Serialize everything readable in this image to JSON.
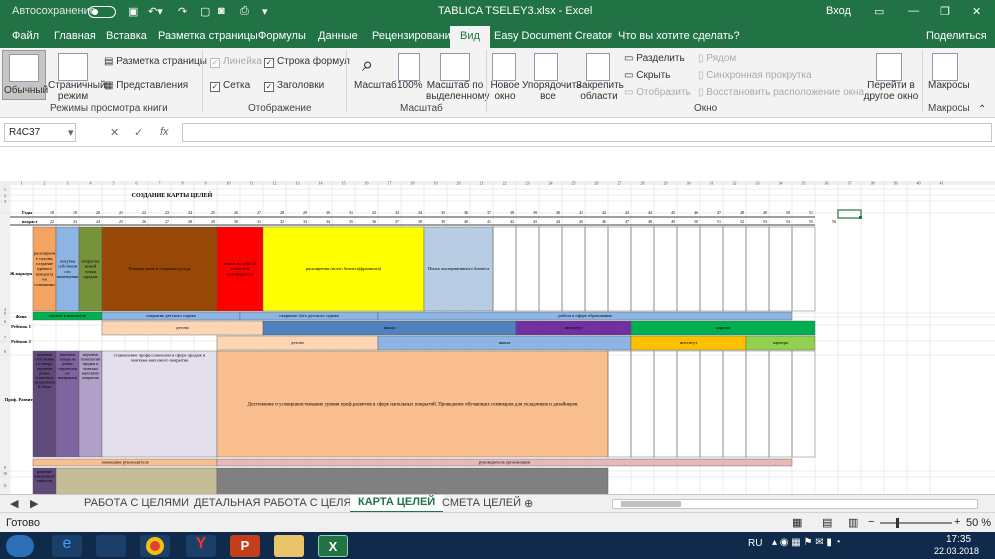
{
  "title_bar": {
    "autosave": "Автосохранение",
    "autosave_state": "Откл.",
    "file_name": "TABLICA TSELEY3.xlsx - Excel",
    "signin": "Вход"
  },
  "menu": [
    "Файл",
    "Главная",
    "Вставка",
    "Разметка страницы",
    "Формулы",
    "Данные",
    "Рецензирование",
    "Вид",
    "Easy Document Creator",
    "Что вы хотите сделать?"
  ],
  "share": "Поделиться",
  "ribbon": {
    "normal": "Обычный",
    "page_mode": "Страничный режим",
    "page_layout": "Разметка страницы",
    "views": "Представления",
    "views_group": "Режимы просмотра книги",
    "ruler": "Линейка",
    "formula_bar": "Строка формул",
    "grid": "Сетка",
    "headings": "Заголовки",
    "show_group": "Отображение",
    "zoom": "Масштаб",
    "zoom100": "100%",
    "zoom_sel": "Масштаб по выделенному",
    "zoom_group": "Масштаб",
    "new_window": "Новое окно",
    "arrange": "Упорядочить все",
    "freeze": "Закрепить области",
    "split": "Разделить",
    "hide": "Скрыть",
    "unhide": "Отобразить",
    "side": "Рядом",
    "sync": "Синхронная прокрутка",
    "reset": "Восстановить расположение окна",
    "switch": "Перейти в другое окно",
    "window_group": "Окно",
    "macros": "Макросы",
    "macros_group": "Макросы"
  },
  "name_box": "R4C37",
  "sheet": {
    "title": "СОЗДАНИЕ КАРТЫ ЦЕЛЕЙ",
    "col_headers": [
      "1",
      "2",
      "3",
      "4",
      "5",
      "6",
      "7",
      "8",
      "9",
      "10",
      "11",
      "12",
      "13",
      "14",
      "15",
      "16",
      "17",
      "18",
      "19",
      "20",
      "21",
      "22",
      "23",
      "24",
      "25",
      "26",
      "27",
      "28",
      "29",
      "30",
      "31",
      "32",
      "33",
      "34",
      "35",
      "36",
      "37",
      "38",
      "39",
      "40",
      "41"
    ],
    "row_headers": [
      "1",
      "2",
      "3",
      "4",
      "5",
      "6",
      "7",
      "8",
      "9",
      "10",
      "11"
    ],
    "years_label": "Годы",
    "age_label": "возраст",
    "years": [
      "18",
      "19",
      "20",
      "21",
      "22",
      "23",
      "24",
      "25",
      "26",
      "27",
      "28",
      "29",
      "30",
      "31",
      "32",
      "33",
      "34",
      "35",
      "36",
      "37",
      "38",
      "39",
      "40",
      "41",
      "42",
      "43",
      "44",
      "45",
      "46",
      "47",
      "48",
      "49",
      "50",
      "51"
    ],
    "ages": [
      "22",
      "23",
      "24",
      "25",
      "26",
      "27",
      "28",
      "29",
      "30",
      "31",
      "32",
      "33",
      "34",
      "35",
      "36",
      "37",
      "38",
      "39",
      "40",
      "41",
      "42",
      "43",
      "44",
      "45",
      "46",
      "47",
      "48",
      "49",
      "50",
      "51",
      "52",
      "53",
      "54",
      "55",
      "56"
    ],
    "career_label": "Ж.карьера",
    "wife_label": "Жена",
    "child1_label": "Ребенок 1",
    "child2_label": "Ребенок 2",
    "prof_label": "Проф. Развитие",
    "c_orange": "расширение салона, создание единого концепта на основании",
    "c_blue": "покупка собственного помещения",
    "c_green": "открытие новой точки продаж",
    "c_brown": "Помощь жене в открытии д.сада",
    "c_red": "поиск на себя 10 новостей руководителя",
    "c_yellow": "расширения своего бизнеса(франшиза)",
    "c_lblue": "Поиск альтернативного бизнеса",
    "w1": "служба в институте",
    "w2": "открытие детского садика",
    "w3": "открытие 2ого детского садика",
    "w4": "работа в сфере образования",
    "k1a": "детсво",
    "k1b": "школа",
    "k1c": "институт",
    "k1d": "карьера",
    "k2a": "детсво",
    "k2b": "школа",
    "k2c": "институт",
    "k2d": "карьера",
    "p1": "изучение собственного товара, изучение рынка станочных предложений сбыта",
    "p2": "изучение товара на рынке строительных материалов",
    "p3": "изучение технологии продаж и монтажа наполного покрытия",
    "p4": "становление профессионалом в сфере продаж и монтажа наполного покрытия",
    "p5": "Достижение и усовершенствование уровня проф.развития в сфере напольных покрытий. Проведение обучающих семинаров для укладчиков и дизайнеров",
    "r11a": "помощник руководителя",
    "r11b": "руководитель организации",
    "r12": "развитие коммуникабельности"
  },
  "tabs": [
    "РАБОТА С ЦЕЛЯМИ",
    "ДЕТАЛЬНАЯ РАБОТА С ЦЕЛЯМИ",
    "КАРТА ЦЕЛЕЙ",
    "СМЕТА ЦЕЛЕЙ"
  ],
  "status": {
    "ready": "Готово",
    "zoom": "50 %"
  },
  "taskbar": {
    "lang": "RU",
    "time": "17:35",
    "date": "22.03.2018"
  }
}
